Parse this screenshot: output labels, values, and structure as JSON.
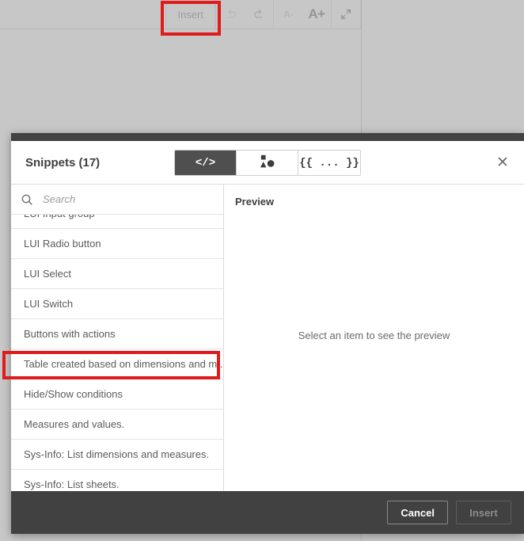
{
  "toolbar": {
    "insert_label": "Insert",
    "undo_icon": "undo-icon",
    "redo_icon": "redo-icon",
    "decrease_font_label": "A-",
    "increase_font_label": "A+",
    "expand_icon": "expand-icon"
  },
  "dialog": {
    "title": "Snippets (17)",
    "close_label": "✕",
    "view_toggle": [
      {
        "id": "code-view",
        "glyph": "</>",
        "active": true
      },
      {
        "id": "shapes-view",
        "glyph": "shapes-icon",
        "active": false
      },
      {
        "id": "variables-view",
        "glyph": "{{ ... }}",
        "active": false
      }
    ],
    "search": {
      "placeholder": "Search",
      "value": "",
      "icon": "search-icon"
    },
    "list": {
      "items": [
        {
          "label": "LUI Input group",
          "highlighted": false
        },
        {
          "label": "LUI Radio button",
          "highlighted": false
        },
        {
          "label": "LUI Select",
          "highlighted": false
        },
        {
          "label": "LUI Switch",
          "highlighted": false
        },
        {
          "label": "Buttons with actions",
          "highlighted": false
        },
        {
          "label": "Table created based on dimensions and m...",
          "highlighted": true
        },
        {
          "label": "Hide/Show conditions",
          "highlighted": false
        },
        {
          "label": "Measures and values.",
          "highlighted": false
        },
        {
          "label": "Sys-Info: List dimensions and measures.",
          "highlighted": false
        },
        {
          "label": "Sys-Info: List sheets.",
          "highlighted": false
        }
      ]
    },
    "preview": {
      "header": "Preview",
      "empty_text": "Select an item to see the preview"
    },
    "footer": {
      "cancel_label": "Cancel",
      "insert_label": "Insert"
    }
  },
  "colors": {
    "dialog_dark": "#414141",
    "toggle_active": "#4f4f4f",
    "annotation": "#e01b1b",
    "overlay": "rgba(180,180,180,0.74)"
  }
}
